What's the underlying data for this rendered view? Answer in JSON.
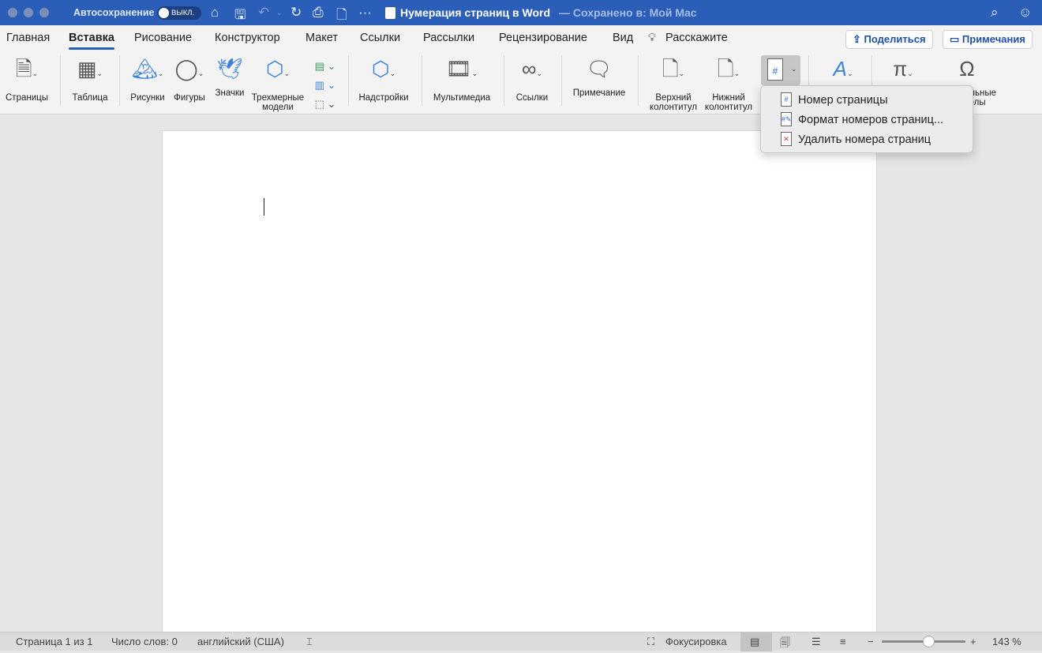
{
  "titlebar": {
    "autosave_label": "Автосохранение",
    "autosave_state": "ВЫКЛ.",
    "doc_title": "Нумерация страниц в Word",
    "saved_status": "— Сохранено в: Мой Mac",
    "accent": "#2b5eb8"
  },
  "tabs": [
    {
      "label": "Главная"
    },
    {
      "label": "Вставка",
      "active": true
    },
    {
      "label": "Рисование"
    },
    {
      "label": "Конструктор"
    },
    {
      "label": "Макет"
    },
    {
      "label": "Ссылки"
    },
    {
      "label": "Рассылки"
    },
    {
      "label": "Рецензирование"
    },
    {
      "label": "Вид"
    },
    {
      "label": "Расскажите"
    }
  ],
  "header_buttons": {
    "share": "Поделиться",
    "comments": "Примечания"
  },
  "ribbon": {
    "pages": "Страницы",
    "table": "Таблица",
    "pictures": "Рисунки",
    "shapes": "Фигуры",
    "icons": "Значки",
    "models_1": "Трехмерные",
    "models_2": "модели",
    "addins": "Надстройки",
    "media": "Мультимедиа",
    "links": "Ссылки",
    "comment": "Примечание",
    "header_1": "Верхний",
    "header_2": "колонтитул",
    "footer_1": "Нижний",
    "footer_2": "колонтитул",
    "symbols_1": "Специальные",
    "symbols_2": "символы"
  },
  "page_number_menu": {
    "items": [
      {
        "label": "Номер страницы",
        "icon": "page-number-icon"
      },
      {
        "label": "Формат номеров страниц...",
        "icon": "format-page-number-icon"
      },
      {
        "label": "Удалить номера страниц",
        "icon": "remove-page-number-icon"
      }
    ]
  },
  "status": {
    "page": "Страница 1 из 1",
    "words": "Число слов: 0",
    "language": "английский (США)",
    "focus": "Фокусировка",
    "zoom": "143 %",
    "zoom_percent": 143
  }
}
